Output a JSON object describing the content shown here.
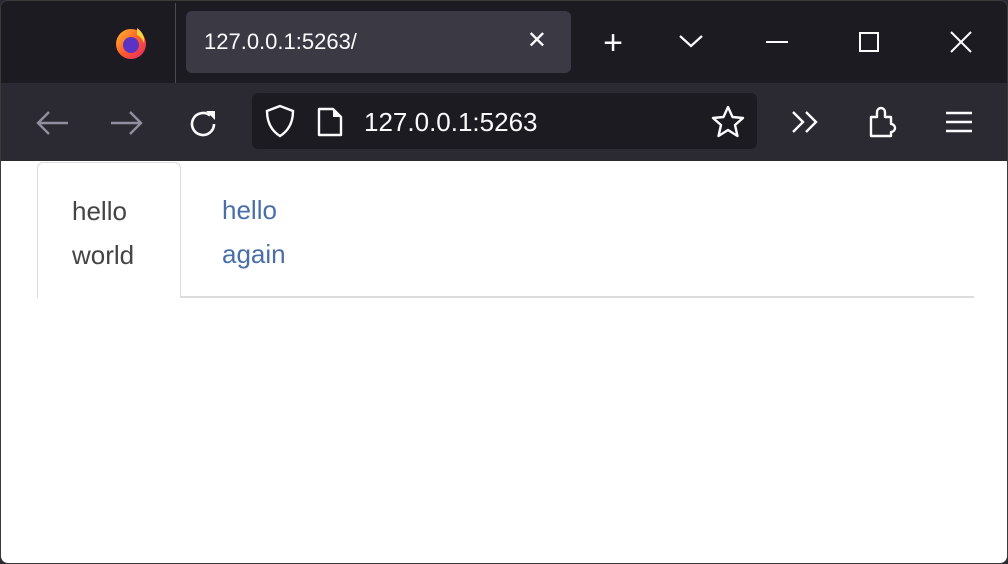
{
  "browser": {
    "tab_title": "127.0.0.1:5263/",
    "url": "127.0.0.1:5263",
    "icons": [
      "firefox-logo",
      "close-icon",
      "plus-icon",
      "chevron-down-icon",
      "minimize-icon",
      "maximize-icon",
      "close-window-icon",
      "back-icon",
      "forward-icon",
      "reload-icon",
      "shield-icon",
      "page-icon",
      "star-icon",
      "overflow-icon",
      "extensions-icon",
      "menu-icon"
    ]
  },
  "page": {
    "tabs": [
      {
        "line1": "hello",
        "line2": "world",
        "active": true
      },
      {
        "line1": "hello",
        "line2": "again",
        "active": false
      }
    ],
    "colors": {
      "active_text": "#444444",
      "link": "#4a6fa8",
      "border": "#dddddd"
    }
  }
}
